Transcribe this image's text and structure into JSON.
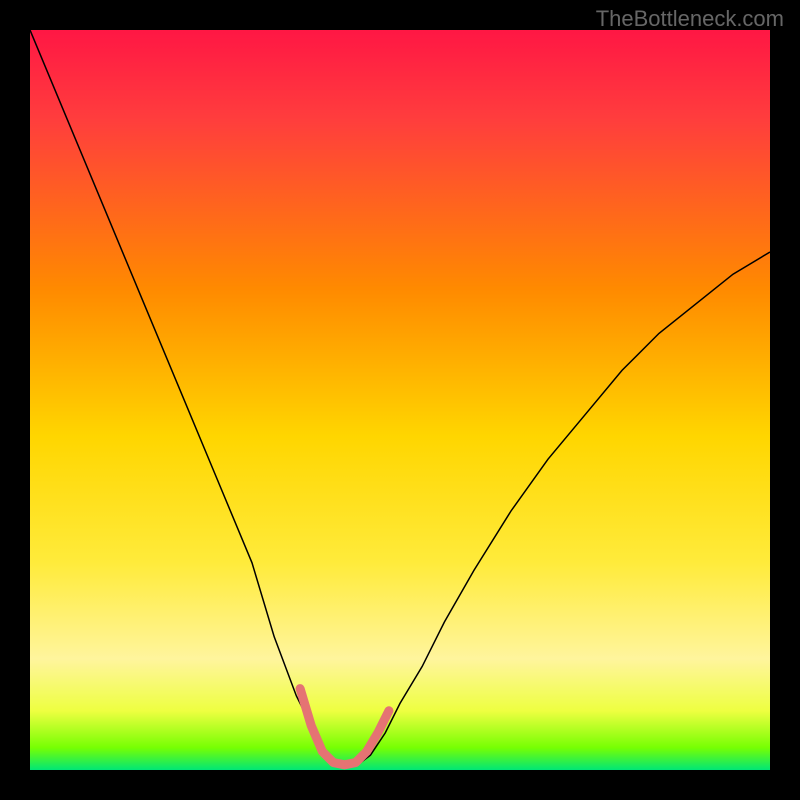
{
  "watermark": "TheBottleneck.com",
  "chart_data": {
    "type": "line",
    "title": "",
    "xlabel": "",
    "ylabel": "",
    "xlim": [
      0,
      100
    ],
    "ylim": [
      0,
      100
    ],
    "gradient_stops": [
      {
        "offset": 0,
        "color": "#ff1744"
      },
      {
        "offset": 0.12,
        "color": "#ff3d3d"
      },
      {
        "offset": 0.35,
        "color": "#ff8a00"
      },
      {
        "offset": 0.55,
        "color": "#ffd600"
      },
      {
        "offset": 0.72,
        "color": "#ffeb3b"
      },
      {
        "offset": 0.85,
        "color": "#fff59d"
      },
      {
        "offset": 0.92,
        "color": "#eeff41"
      },
      {
        "offset": 0.97,
        "color": "#76ff03"
      },
      {
        "offset": 1.0,
        "color": "#00e676"
      }
    ],
    "series": [
      {
        "name": "bottleneck-curve",
        "stroke": "#000000",
        "stroke_width": 1.5,
        "x": [
          0,
          5,
          10,
          15,
          20,
          25,
          30,
          33,
          36,
          39,
          41,
          42.5,
          44,
          46,
          48,
          50,
          53,
          56,
          60,
          65,
          70,
          75,
          80,
          85,
          90,
          95,
          100
        ],
        "y": [
          100,
          88,
          76,
          64,
          52,
          40,
          28,
          18,
          10,
          4,
          1,
          0.5,
          0.5,
          2,
          5,
          9,
          14,
          20,
          27,
          35,
          42,
          48,
          54,
          59,
          63,
          67,
          70
        ]
      }
    ],
    "highlight": {
      "name": "optimal-range",
      "stroke": "#e57373",
      "stroke_width": 9,
      "x": [
        36.5,
        38,
        39.5,
        41,
        42.5,
        44,
        45.5,
        47,
        48.5
      ],
      "y": [
        11,
        6,
        2.5,
        1,
        0.7,
        1,
        2.5,
        5,
        8
      ]
    }
  }
}
